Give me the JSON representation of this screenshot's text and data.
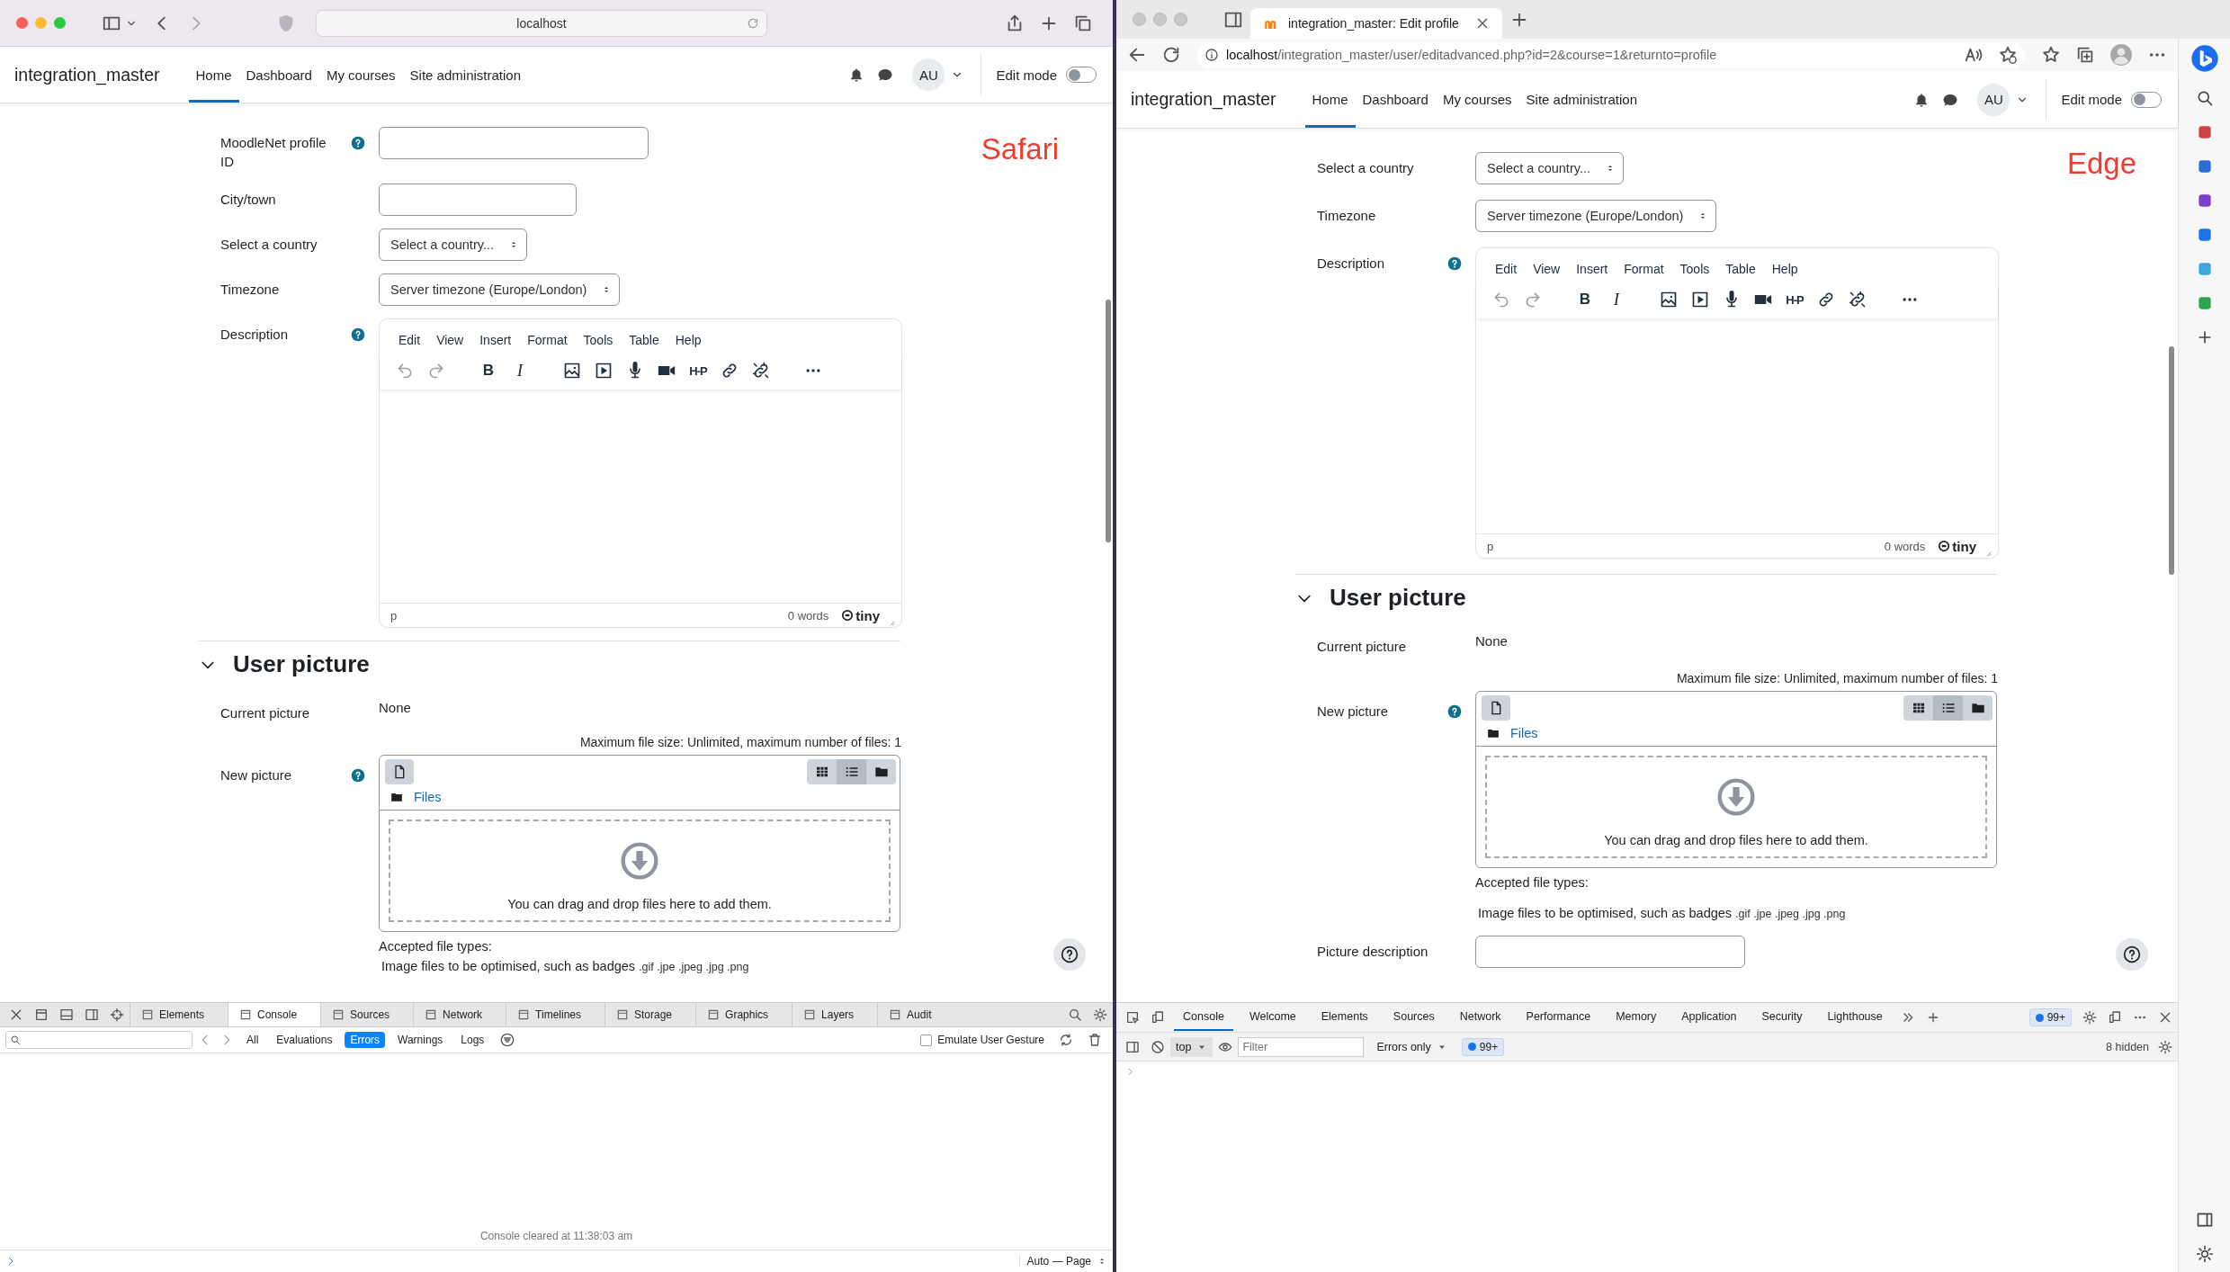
{
  "windows": [
    {
      "kind": "safari",
      "address": "localhost",
      "site_name": "integration_master",
      "nav": [
        {
          "label": "Home",
          "selected": true
        },
        {
          "label": "Dashboard",
          "selected": false
        },
        {
          "label": "My courses",
          "selected": false
        },
        {
          "label": "Site administration",
          "selected": false
        }
      ],
      "user_initials": "AU",
      "edit_mode_label": "Edit mode",
      "edit_mode_on": false,
      "annotation": "Safari",
      "form": [
        {
          "kind": "text",
          "label": "MoodleNet profile ID",
          "help": true
        },
        {
          "kind": "text",
          "label": "City/town",
          "help": false
        },
        {
          "kind": "select",
          "label": "Select a country",
          "help": false,
          "value": "Select a country..."
        },
        {
          "kind": "select",
          "label": "Timezone",
          "help": false,
          "value": "Server timezone (Europe/London)"
        },
        {
          "kind": "editor",
          "label": "Description",
          "help": true,
          "menu": [
            "Edit",
            "View",
            "Insert",
            "Format",
            "Tools",
            "Table",
            "Help"
          ],
          "bold": "B",
          "italic": "I",
          "h5p": "H-P",
          "path": "p",
          "word_count": "0 words",
          "brand": "tiny"
        },
        {
          "kind": "section",
          "title": "User picture",
          "expanded": true
        },
        {
          "kind": "static",
          "label": "Current picture",
          "help": false,
          "value": "None"
        },
        {
          "kind": "filepicker",
          "label": "New picture",
          "help": true,
          "limits": "Maximum file size: Unlimited, maximum number of files: 1",
          "views": [
            {
              "kind": "grid",
              "selected": false
            },
            {
              "kind": "list",
              "selected": true
            },
            {
              "kind": "tree",
              "selected": false
            }
          ],
          "folder": "Files",
          "drop_text": "You can drag and drop files here to add them.",
          "accepted_label": "Accepted file types:",
          "accepted_desc": "Image files to be optimised, such as badges",
          "accepted_ext": ".gif .jpe .jpeg .jpg .png"
        }
      ],
      "devtools": {
        "tabs": [
          {
            "label": "Elements",
            "selected": false
          },
          {
            "label": "Console",
            "selected": true
          },
          {
            "label": "Sources",
            "selected": false
          },
          {
            "label": "Network",
            "selected": false
          },
          {
            "label": "Timelines",
            "selected": false
          },
          {
            "label": "Storage",
            "selected": false
          },
          {
            "label": "Graphics",
            "selected": false
          },
          {
            "label": "Layers",
            "selected": false
          },
          {
            "label": "Audit",
            "selected": false
          }
        ],
        "filters": [
          {
            "label": "All",
            "selected": false
          },
          {
            "label": "Evaluations",
            "selected": false
          },
          {
            "label": "Errors",
            "selected": true
          },
          {
            "label": "Warnings",
            "selected": false
          },
          {
            "label": "Logs",
            "selected": false
          }
        ],
        "emulate_label": "Emulate User Gesture",
        "emulate_checked": false,
        "message": "Console cleared at 11:38:03 am",
        "mode": "Auto — Page"
      }
    },
    {
      "kind": "edge",
      "tab_title": "integration_master: Edit profile",
      "url_host": "localhost",
      "url_path": "/integration_master/user/editadvanced.php?id=2&course=1&returnto=profile",
      "site_name": "integration_master",
      "nav": [
        {
          "label": "Home",
          "selected": true
        },
        {
          "label": "Dashboard",
          "selected": false
        },
        {
          "label": "My courses",
          "selected": false
        },
        {
          "label": "Site administration",
          "selected": false
        }
      ],
      "user_initials": "AU",
      "edit_mode_label": "Edit mode",
      "edit_mode_on": false,
      "annotation": "Edge",
      "form": [
        {
          "kind": "select",
          "label": "Select a country",
          "help": false,
          "value": "Select a country..."
        },
        {
          "kind": "select",
          "label": "Timezone",
          "help": false,
          "value": "Server timezone (Europe/London)"
        },
        {
          "kind": "editor",
          "label": "Description",
          "help": true,
          "menu": [
            "Edit",
            "View",
            "Insert",
            "Format",
            "Tools",
            "Table",
            "Help"
          ],
          "bold": "B",
          "italic": "I",
          "h5p": "H-P",
          "path": "p",
          "word_count": "0 words",
          "brand": "tiny"
        },
        {
          "kind": "section",
          "title": "User picture",
          "expanded": true
        },
        {
          "kind": "static",
          "label": "Current picture",
          "help": false,
          "value": "None"
        },
        {
          "kind": "filepicker",
          "label": "New picture",
          "help": true,
          "limits": "Maximum file size: Unlimited, maximum number of files: 1",
          "views": [
            {
              "kind": "grid",
              "selected": false
            },
            {
              "kind": "list",
              "selected": true
            },
            {
              "kind": "tree",
              "selected": false
            }
          ],
          "folder": "Files",
          "drop_text": "You can drag and drop files here to add them.",
          "accepted_label": "Accepted file types:",
          "accepted_desc": "Image files to be optimised, such as badges",
          "accepted_ext": ".gif .jpe .jpeg .jpg .png"
        },
        {
          "kind": "text",
          "label": "Picture description",
          "help": false
        }
      ],
      "devtools": {
        "tabs": [
          {
            "label": "Console",
            "selected": true
          },
          {
            "label": "Welcome",
            "selected": false
          },
          {
            "label": "Elements",
            "selected": false
          },
          {
            "label": "Sources",
            "selected": false
          },
          {
            "label": "Network",
            "selected": false
          },
          {
            "label": "Performance",
            "selected": false
          },
          {
            "label": "Memory",
            "selected": false
          },
          {
            "label": "Application",
            "selected": false
          },
          {
            "label": "Security",
            "selected": false
          },
          {
            "label": "Lighthouse",
            "selected": false
          }
        ],
        "issues": "99+",
        "context": "top",
        "filter_placeholder": "Filter",
        "level": "Errors only",
        "count": "99+",
        "hidden": "8 hidden"
      }
    }
  ]
}
